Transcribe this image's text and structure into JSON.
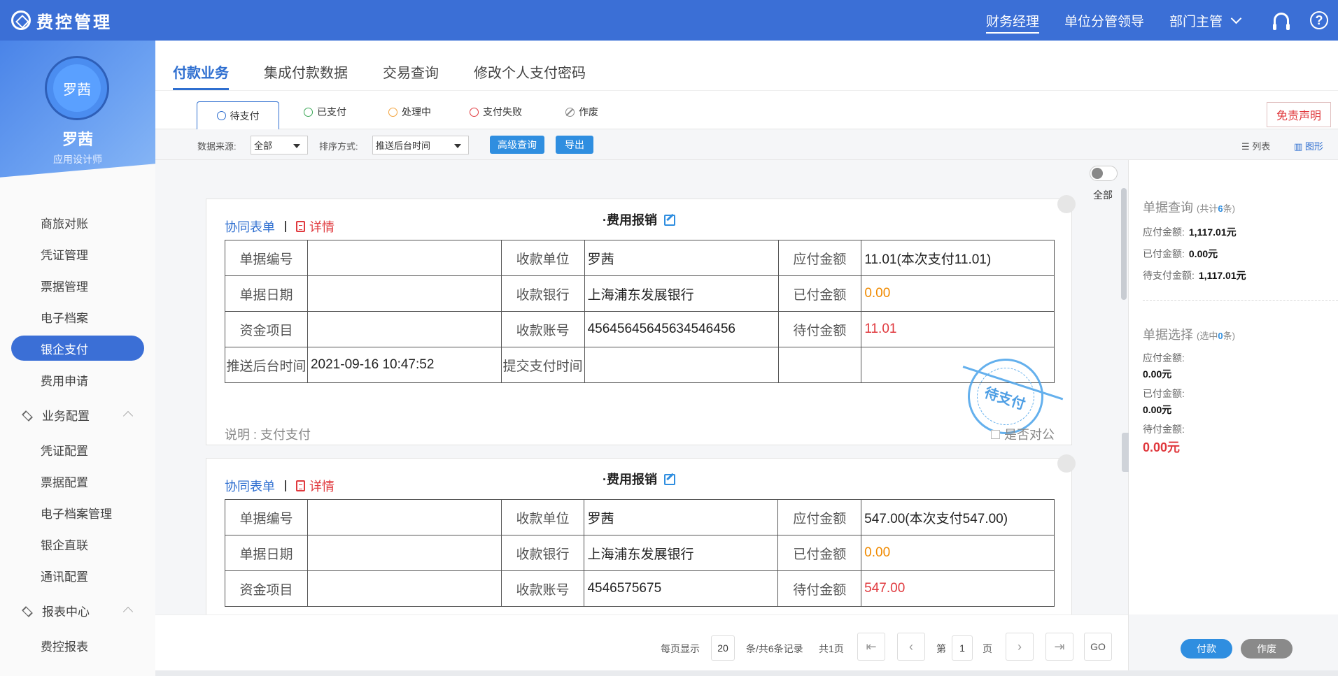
{
  "app": {
    "title": "费控管理"
  },
  "top_nav": {
    "items": [
      {
        "label": "财务经理",
        "active": true
      },
      {
        "label": "单位分管领导",
        "active": false
      },
      {
        "label": "部门主管",
        "active": false
      }
    ]
  },
  "profile": {
    "avatar_text": "罗茜",
    "name": "罗茜",
    "role": "应用设计师"
  },
  "sidebar": {
    "items": [
      "商旅对账",
      "凭证管理",
      "票据管理",
      "电子档案",
      "银企支付",
      "费用申请"
    ],
    "active_item": "银企支付",
    "group1": {
      "label": "业务配置",
      "items": [
        "凭证配置",
        "票据配置",
        "电子档案管理",
        "银企直联",
        "通讯配置"
      ]
    },
    "group2": {
      "label": "报表中心",
      "items": [
        "费控报表"
      ]
    }
  },
  "tabs": [
    "付款业务",
    "集成付款数据",
    "交易查询",
    "修改个人支付密码"
  ],
  "subtabs": [
    "待支付",
    "已支付",
    "处理中",
    "支付失败",
    "作废"
  ],
  "disclaimer": "免责声明",
  "filter": {
    "source_label": "数据来源:",
    "source_value": "全部",
    "sort_label": "排序方式:",
    "sort_value": "推送后台时间",
    "advanced_btn": "高级查询",
    "export_btn": "导出",
    "view_list": "列表",
    "view_chart": "图形"
  },
  "toggle_label": "全部",
  "cards": [
    {
      "title": "·费用报销",
      "link_form": "协同表单",
      "link_detail": "详情",
      "rows": [
        [
          "单据编号",
          "",
          "收款单位",
          "罗茜",
          "应付金额",
          "11.01(本次支付11.01)"
        ],
        [
          "单据日期",
          "",
          "收款银行",
          "上海浦东发展银行",
          "已付金额",
          "0.00"
        ],
        [
          "资金项目",
          "",
          "收款账号",
          "45645645645634546456",
          "待付金额",
          "11.01"
        ],
        [
          "推送后台时间",
          "2021-09-16 10:47:52",
          "提交支付时间",
          "",
          "",
          ""
        ]
      ],
      "note": "说明 : 支付支付",
      "public_label": "是否对公",
      "stamp": "待支付"
    },
    {
      "title": "·费用报销",
      "link_form": "协同表单",
      "link_detail": "详情",
      "rows": [
        [
          "单据编号",
          "",
          "收款单位",
          "罗茜",
          "应付金额",
          "547.00(本次支付547.00)"
        ],
        [
          "单据日期",
          "",
          "收款银行",
          "上海浦东发展银行",
          "已付金额",
          "0.00"
        ],
        [
          "资金项目",
          "",
          "收款账号",
          "4546575675",
          "待付金额",
          "547.00"
        ]
      ]
    }
  ],
  "summary": {
    "query_title": "单据查询",
    "query_count_prefix": "(共计",
    "query_count": "6",
    "query_count_suffix": "条)",
    "payable_label": "应付金额:",
    "payable_value": "1,117.01元",
    "paid_label": "已付金额:",
    "paid_value": "0.00元",
    "pending_label": "待支付金额:",
    "pending_value": "1,117.01元",
    "select_title": "单据选择",
    "select_count_prefix": "(选中",
    "select_count": "0",
    "select_count_suffix": "条)",
    "sel_payable_label": "应付金额:",
    "sel_payable_value": "0.00元",
    "sel_paid_label": "已付金额:",
    "sel_paid_value": "0.00元",
    "sel_pending_label": "待付金额:",
    "sel_pending_value": "0.00元",
    "pay_btn": "付款",
    "void_btn": "作废"
  },
  "pager": {
    "per_page_label": "每页显示",
    "per_page": "20",
    "records": "条/共6条记录",
    "pages": "共1页",
    "page_prefix": "第",
    "page": "1",
    "page_suffix": "页",
    "go": "GO"
  }
}
